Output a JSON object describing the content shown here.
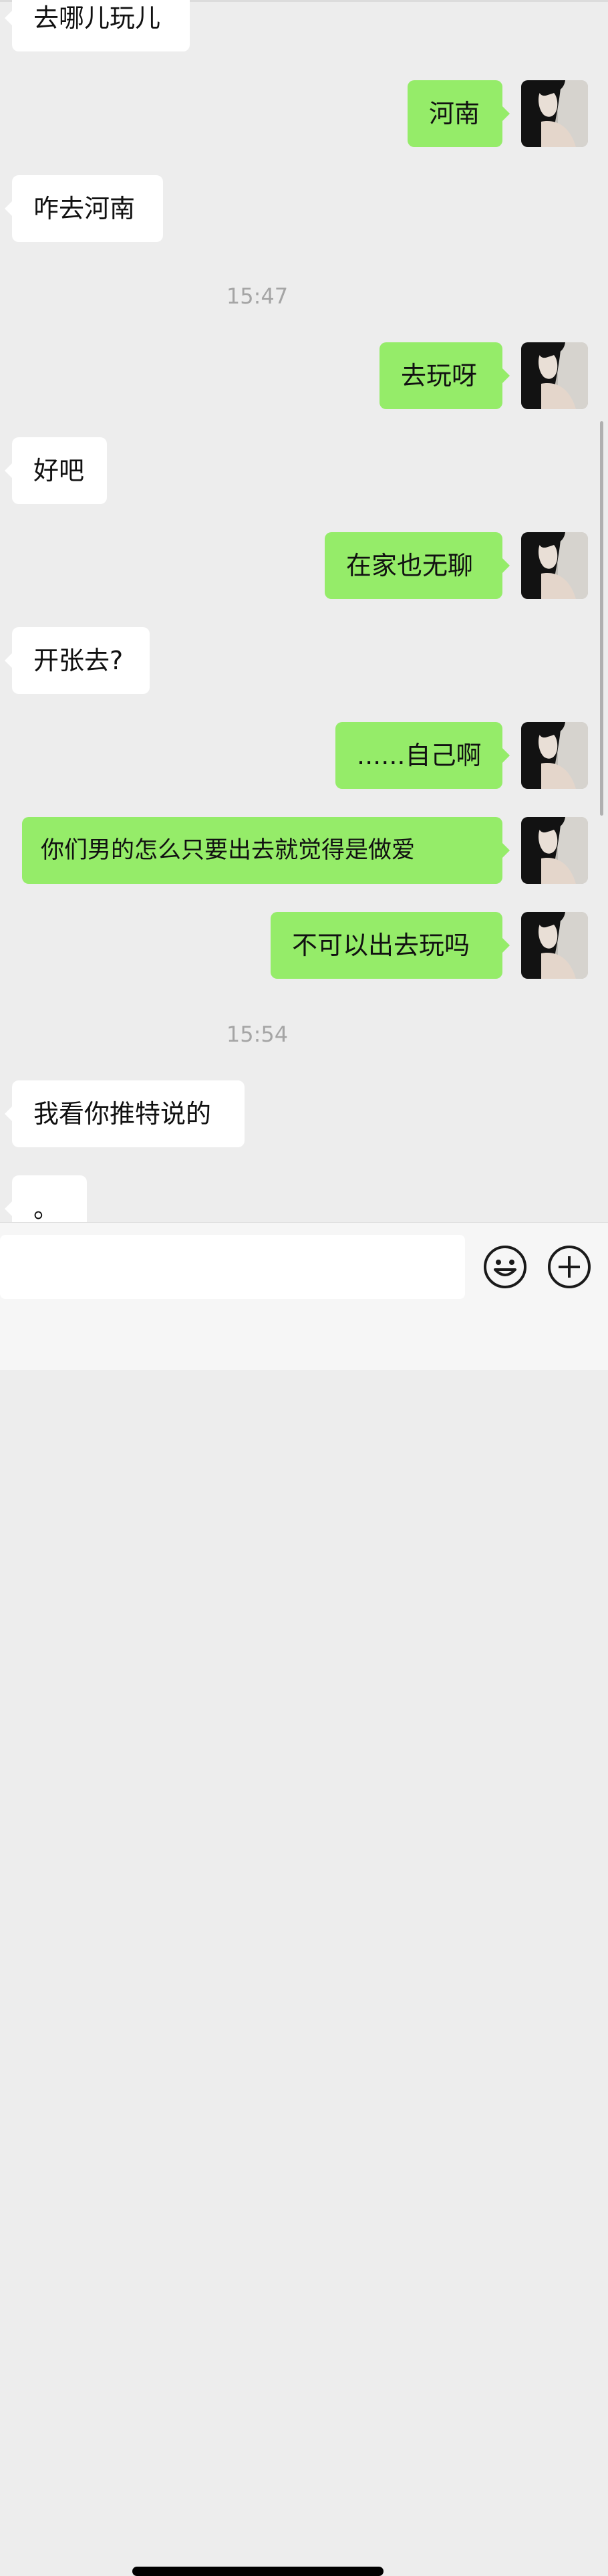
{
  "messages": [
    {
      "side": "in",
      "text": "去哪儿玩儿"
    },
    {
      "side": "out",
      "text": "河南"
    },
    {
      "side": "in",
      "text": "咋去河南"
    },
    {
      "time": "15:47"
    },
    {
      "side": "out",
      "text": "去玩呀"
    },
    {
      "side": "in",
      "text": "好吧"
    },
    {
      "side": "out",
      "text": "在家也无聊"
    },
    {
      "side": "in",
      "text": "开张去?"
    },
    {
      "side": "out",
      "text": "......自己啊"
    },
    {
      "side": "out",
      "text": "你们男的怎么只要出去就觉得是做爱"
    },
    {
      "side": "out",
      "text": "不可以出去玩吗"
    },
    {
      "time": "15:54"
    },
    {
      "side": "in",
      "text": "我看你推特说的"
    },
    {
      "side": "in",
      "text": "。"
    }
  ],
  "input": {
    "value": "",
    "placeholder": ""
  },
  "icons": {
    "emoji": "smiley-face-icon",
    "more": "plus-circle-icon",
    "avatar": "profile-photo"
  },
  "colors": {
    "background": "#ededed",
    "outgoing": "#95ec69",
    "incoming": "#ffffff",
    "timestamp": "#a5a5a5"
  }
}
